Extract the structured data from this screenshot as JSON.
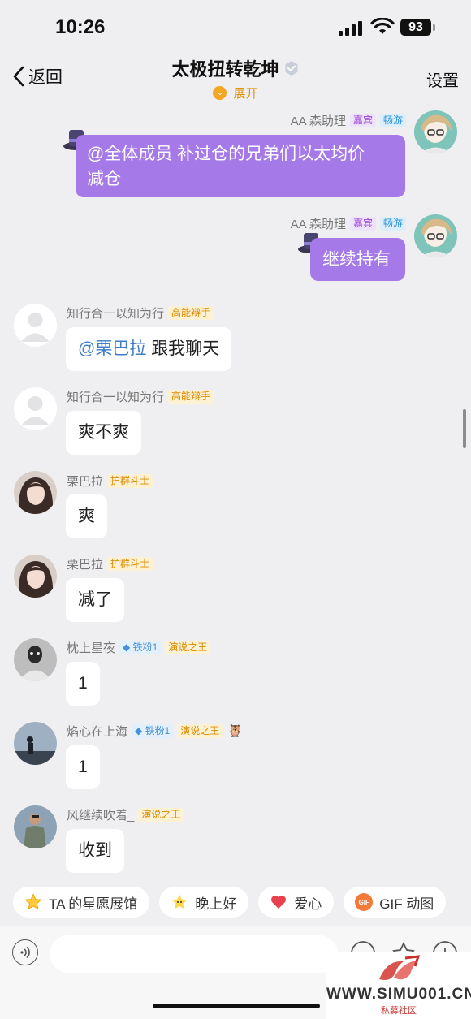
{
  "status_bar": {
    "time": "10:26",
    "battery": "93"
  },
  "nav": {
    "back_label": "返回",
    "title": "太极扭转乾坤",
    "expand_label": "展开",
    "settings_label": "设置"
  },
  "messages": [
    {
      "sender": "AA 森助理",
      "badges": [
        "嘉宾",
        "畅游"
      ],
      "text": "@全体成员 补过仓的兄弟们以太均价减仓",
      "text_line1": "@全体成员 补过仓的兄弟们以太均价",
      "text_line2": "减仓",
      "outgoing": true
    },
    {
      "sender": "AA 森助理",
      "badges": [
        "嘉宾",
        "畅游"
      ],
      "text": "继续持有",
      "outgoing": true
    },
    {
      "sender": "知行合一以知为行",
      "badges": [
        "高能辩手"
      ],
      "mention": "@栗巴拉",
      "text": " 跟我聊天"
    },
    {
      "sender": "知行合一以知为行",
      "badges": [
        "高能辩手"
      ],
      "text": "爽不爽"
    },
    {
      "sender": "栗巴拉",
      "badges": [
        "护群斗士"
      ],
      "text": "爽"
    },
    {
      "sender": "栗巴拉",
      "badges": [
        "护群斗士"
      ],
      "text": "减了"
    },
    {
      "sender": "枕上星夜",
      "badges": [
        "铁粉1",
        "演说之王"
      ],
      "text": "1"
    },
    {
      "sender": "焰心在上海",
      "badges": [
        "铁粉1",
        "演说之王"
      ],
      "text": "1"
    },
    {
      "sender": "风继续吹着_",
      "badges": [
        "演说之王"
      ],
      "text": "收到"
    }
  ],
  "quick_replies": [
    {
      "label": "TA 的星愿展馆",
      "icon": "star-icon"
    },
    {
      "label": "晚上好",
      "icon": "sparkle-emoji-icon"
    },
    {
      "label": "爱心",
      "icon": "heart-icon"
    },
    {
      "label": "GIF 动图",
      "icon": "gif-icon",
      "icon_text": "GIF"
    }
  ],
  "input": {
    "placeholder": ""
  },
  "watermark": {
    "url": "WWW.SIMU001.CN",
    "sub": "私募社区"
  },
  "colors": {
    "outgoing_bubble": "#a679e8",
    "accent_orange": "#f5a623",
    "mention": "#3d7cc9",
    "background": "#efeff1"
  }
}
